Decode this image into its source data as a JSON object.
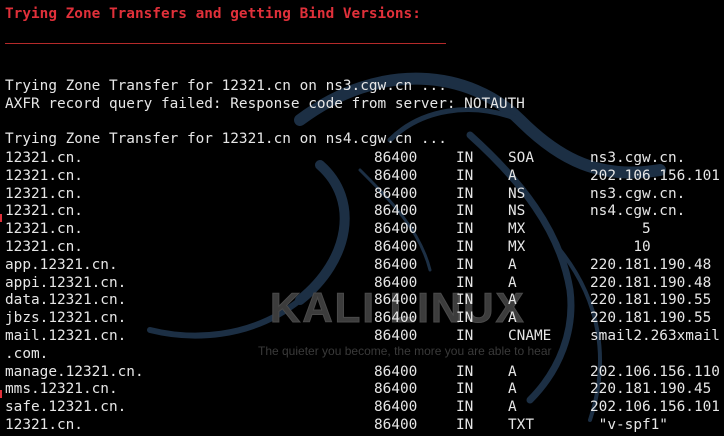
{
  "wallpaper": {
    "logo_text": "KALI LINUX",
    "tagline": "The quieter you become, the more you are able to hear"
  },
  "terminal": {
    "heading": "Trying Zone Transfers and getting Bind Versions:",
    "rule": "_________________________________________________",
    "lines": [
      "Trying Zone Transfer for 12321.cn on ns3.cgw.cn ...",
      "AXFR record query failed: Response code from server: NOTAUTH",
      "",
      "Trying Zone Transfer for 12321.cn on ns4.cgw.cn ..."
    ],
    "records": [
      {
        "name": "12321.cn.",
        "ttl": "86400",
        "class": "IN",
        "type": "SOA",
        "value": "ns3.cgw.cn."
      },
      {
        "name": "12321.cn.",
        "ttl": "86400",
        "class": "IN",
        "type": "A",
        "value": "202.106.156.101"
      },
      {
        "name": "12321.cn.",
        "ttl": "86400",
        "class": "IN",
        "type": "NS",
        "value": "ns3.cgw.cn."
      },
      {
        "name": "12321.cn.",
        "ttl": "86400",
        "class": "IN",
        "type": "NS",
        "value": "ns4.cgw.cn."
      },
      {
        "name": "12321.cn.",
        "ttl": "86400",
        "class": "IN",
        "type": "MX",
        "value": "      5"
      },
      {
        "name": "12321.cn.",
        "ttl": "86400",
        "class": "IN",
        "type": "MX",
        "value": "     10"
      },
      {
        "name": "app.12321.cn.",
        "ttl": "86400",
        "class": "IN",
        "type": "A",
        "value": "220.181.190.48"
      },
      {
        "name": "appi.12321.cn.",
        "ttl": "86400",
        "class": "IN",
        "type": "A",
        "value": "220.181.190.48"
      },
      {
        "name": "data.12321.cn.",
        "ttl": "86400",
        "class": "IN",
        "type": "A",
        "value": "220.181.190.55"
      },
      {
        "name": "jbzs.12321.cn.",
        "ttl": "86400",
        "class": "IN",
        "type": "A",
        "value": "220.181.190.55"
      },
      {
        "name": "mail.12321.cn.",
        "ttl": "86400",
        "class": "IN",
        "type": "CNAME",
        "value": "smail2.263xmail"
      },
      {
        "name": ".com.",
        "ttl": "",
        "class": "",
        "type": "",
        "value": ""
      },
      {
        "name": "manage.12321.cn.",
        "ttl": "86400",
        "class": "IN",
        "type": "A",
        "value": "202.106.156.110"
      },
      {
        "name": "mms.12321.cn.",
        "ttl": "86400",
        "class": "IN",
        "type": "A",
        "value": "220.181.190.45"
      },
      {
        "name": "safe.12321.cn.",
        "ttl": "86400",
        "class": "IN",
        "type": "A",
        "value": "202.106.156.101"
      },
      {
        "name": "12321.cn.",
        "ttl": "86400",
        "class": "IN",
        "type": "TXT",
        "value": " \"v-spf1\""
      }
    ]
  },
  "colors": {
    "background": "#000000",
    "text": "#e6e6e6",
    "heading": "#e0303a",
    "dragon": "#1c2f44"
  }
}
